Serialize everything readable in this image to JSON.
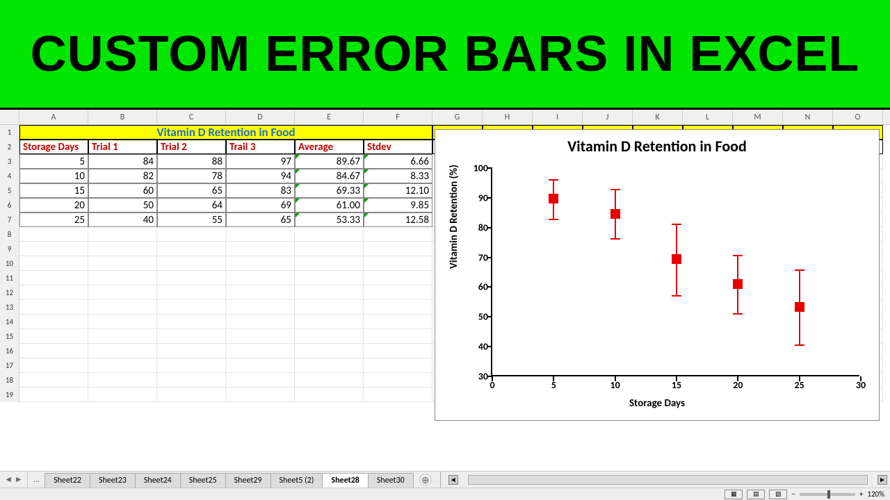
{
  "banner": "CUSTOM ERROR BARS IN EXCEL",
  "columns": [
    "A",
    "B",
    "C",
    "D",
    "E",
    "F",
    "G",
    "H",
    "I",
    "J",
    "K",
    "L",
    "M",
    "N",
    "O"
  ],
  "row_nums": [
    1,
    2,
    3,
    4,
    5,
    6,
    7,
    8,
    9,
    10,
    11,
    12,
    13,
    14,
    15,
    16,
    17,
    18,
    19
  ],
  "table": {
    "title": "Vitamin D Retention in Food",
    "headers": [
      "Storage Days",
      "Trial 1",
      "Trial 2",
      "Trail 3",
      "Average",
      "Stdev"
    ],
    "rows": [
      {
        "d": "5",
        "t1": "84",
        "t2": "88",
        "t3": "97",
        "avg": "89.67",
        "sd": "6.66"
      },
      {
        "d": "10",
        "t1": "82",
        "t2": "78",
        "t3": "94",
        "avg": "84.67",
        "sd": "8.33"
      },
      {
        "d": "15",
        "t1": "60",
        "t2": "65",
        "t3": "83",
        "avg": "69.33",
        "sd": "12.10"
      },
      {
        "d": "20",
        "t1": "50",
        "t2": "64",
        "t3": "69",
        "avg": "61.00",
        "sd": "9.85"
      },
      {
        "d": "25",
        "t1": "40",
        "t2": "55",
        "t3": "65",
        "avg": "53.33",
        "sd": "12.58"
      }
    ]
  },
  "chart_data": {
    "type": "scatter",
    "title": "Vitamin D Retention in Food",
    "xlabel": "Storage Days",
    "ylabel": "Vitamin D Retention (%)",
    "xlim": [
      0,
      30
    ],
    "ylim": [
      30,
      100
    ],
    "xticks": [
      0,
      5,
      10,
      15,
      20,
      25,
      30
    ],
    "yticks": [
      30,
      40,
      50,
      60,
      70,
      80,
      90,
      100
    ],
    "x": [
      5,
      10,
      15,
      20,
      25
    ],
    "y": [
      89.67,
      84.67,
      69.33,
      61.0,
      53.33
    ],
    "yerr": [
      6.66,
      8.33,
      12.1,
      9.85,
      12.58
    ],
    "series_color": "#e60000"
  },
  "tabs": [
    "Sheet22",
    "Sheet23",
    "Sheet24",
    "Sheet25",
    "Sheet29",
    "Sheet5 (2)",
    "Sheet28",
    "Sheet30"
  ],
  "active_tab": "Sheet28",
  "zoom": "120%"
}
